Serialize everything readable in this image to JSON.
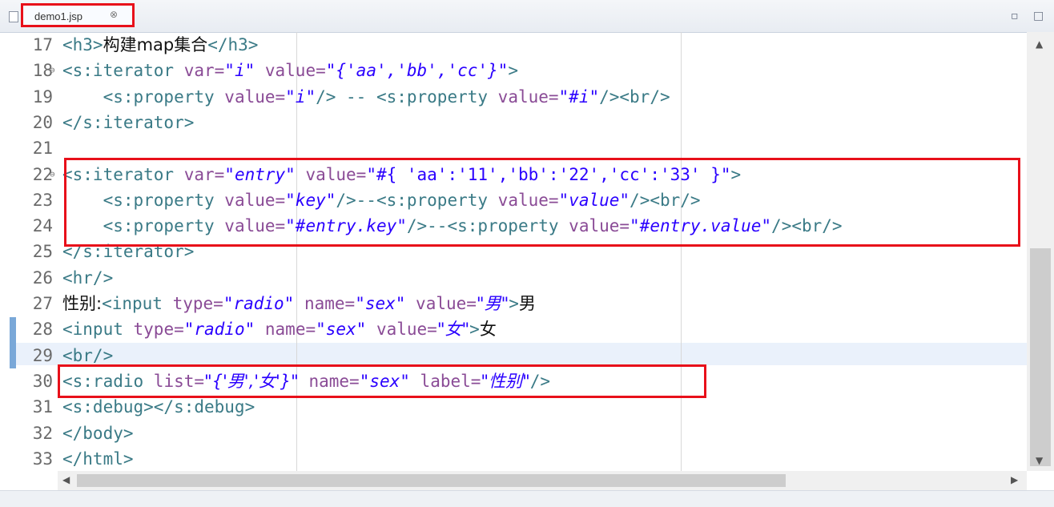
{
  "tab": {
    "label": "demo1.jsp",
    "close": "⊗"
  },
  "window_controls": {
    "minimize": "▫",
    "maximize": "□"
  },
  "code": [
    {
      "ln": "17",
      "fold": "",
      "parts": [
        {
          "t": "<h3>",
          "c": "tag"
        },
        {
          "t": "构建map集合",
          "c": "txt cjk"
        },
        {
          "t": "</h3>",
          "c": "tag"
        }
      ]
    },
    {
      "ln": "18",
      "fold": "⊖",
      "parts": [
        {
          "t": "<s:iterator ",
          "c": "tag"
        },
        {
          "t": "var=",
          "c": "attr"
        },
        {
          "t": "\"i\"",
          "c": "str"
        },
        {
          "t": " value=",
          "c": "attr"
        },
        {
          "t": "\"{'aa','bb','cc'}\"",
          "c": "str"
        },
        {
          "t": ">",
          "c": "tag"
        }
      ]
    },
    {
      "ln": "19",
      "fold": "",
      "parts": [
        {
          "t": "    <s:property ",
          "c": "tag"
        },
        {
          "t": "value=",
          "c": "attr"
        },
        {
          "t": "\"i\"",
          "c": "str"
        },
        {
          "t": "/> -- ",
          "c": "tag"
        },
        {
          "t": "<s:property ",
          "c": "tag"
        },
        {
          "t": "value=",
          "c": "attr"
        },
        {
          "t": "\"#i\"",
          "c": "str"
        },
        {
          "t": "/><br/>",
          "c": "tag"
        }
      ]
    },
    {
      "ln": "20",
      "fold": "",
      "parts": [
        {
          "t": "</s:iterator>",
          "c": "tag"
        }
      ]
    },
    {
      "ln": "21",
      "fold": "",
      "parts": []
    },
    {
      "ln": "22",
      "fold": "⊖",
      "parts": [
        {
          "t": "<s:iterator ",
          "c": "tag"
        },
        {
          "t": "var=",
          "c": "attr"
        },
        {
          "t": "\"entry\"",
          "c": "str"
        },
        {
          "t": " value=",
          "c": "attr"
        },
        {
          "t": "\"#{ 'aa':'11','bb':'22','cc':'33' }\"",
          "c": "strn"
        },
        {
          "t": ">",
          "c": "tag"
        }
      ]
    },
    {
      "ln": "23",
      "fold": "",
      "parts": [
        {
          "t": "    <s:property ",
          "c": "tag"
        },
        {
          "t": "value=",
          "c": "attr"
        },
        {
          "t": "\"key\"",
          "c": "str"
        },
        {
          "t": "/>--",
          "c": "tag"
        },
        {
          "t": "<s:property ",
          "c": "tag"
        },
        {
          "t": "value=",
          "c": "attr"
        },
        {
          "t": "\"value\"",
          "c": "str"
        },
        {
          "t": "/><br/>",
          "c": "tag"
        }
      ]
    },
    {
      "ln": "24",
      "fold": "",
      "parts": [
        {
          "t": "    <s:property ",
          "c": "tag"
        },
        {
          "t": "value=",
          "c": "attr"
        },
        {
          "t": "\"#entry.key\"",
          "c": "str"
        },
        {
          "t": "/>--",
          "c": "tag"
        },
        {
          "t": "<s:property ",
          "c": "tag"
        },
        {
          "t": "value=",
          "c": "attr"
        },
        {
          "t": "\"#entry.value\"",
          "c": "str"
        },
        {
          "t": "/><br/>",
          "c": "tag"
        }
      ]
    },
    {
      "ln": "25",
      "fold": "",
      "parts": [
        {
          "t": "</s:iterator>",
          "c": "tag"
        }
      ]
    },
    {
      "ln": "26",
      "fold": "",
      "parts": [
        {
          "t": "<hr/>",
          "c": "tag"
        }
      ]
    },
    {
      "ln": "27",
      "fold": "",
      "parts": [
        {
          "t": "性别:",
          "c": "txt cjk"
        },
        {
          "t": "<input ",
          "c": "tag"
        },
        {
          "t": "type=",
          "c": "attr"
        },
        {
          "t": "\"radio\"",
          "c": "str"
        },
        {
          "t": " name=",
          "c": "attr"
        },
        {
          "t": "\"sex\"",
          "c": "str"
        },
        {
          "t": " value=",
          "c": "attr"
        },
        {
          "t": "\"男\"",
          "c": "str cjk"
        },
        {
          "t": ">",
          "c": "tag"
        },
        {
          "t": "男",
          "c": "txt cjk"
        }
      ]
    },
    {
      "ln": "28",
      "fold": "",
      "parts": [
        {
          "t": "<input ",
          "c": "tag"
        },
        {
          "t": "type=",
          "c": "attr"
        },
        {
          "t": "\"radio\"",
          "c": "str"
        },
        {
          "t": " name=",
          "c": "attr"
        },
        {
          "t": "\"sex\"",
          "c": "str"
        },
        {
          "t": " value=",
          "c": "attr"
        },
        {
          "t": "\"女\"",
          "c": "str cjk"
        },
        {
          "t": ">",
          "c": "tag"
        },
        {
          "t": "女",
          "c": "txt cjk"
        }
      ]
    },
    {
      "ln": "29",
      "fold": "",
      "parts": [
        {
          "t": "<br/>",
          "c": "tag"
        }
      ]
    },
    {
      "ln": "30",
      "fold": "",
      "parts": [
        {
          "t": "<s:radio ",
          "c": "tag"
        },
        {
          "t": "list=",
          "c": "attr"
        },
        {
          "t": "\"{'男','女'}\"",
          "c": "str cjk"
        },
        {
          "t": " name=",
          "c": "attr"
        },
        {
          "t": "\"sex\"",
          "c": "str"
        },
        {
          "t": " label=",
          "c": "attr"
        },
        {
          "t": "\"性别\"",
          "c": "str cjk"
        },
        {
          "t": "/>",
          "c": "tag"
        }
      ]
    },
    {
      "ln": "31",
      "fold": "",
      "parts": [
        {
          "t": "<s:debug></s:debug>",
          "c": "tag"
        }
      ]
    },
    {
      "ln": "32",
      "fold": "",
      "parts": [
        {
          "t": "</body>",
          "c": "tag"
        }
      ]
    },
    {
      "ln": "33",
      "fold": "",
      "parts": [
        {
          "t": "</html>",
          "c": "tag"
        }
      ]
    }
  ],
  "scroll": {
    "up": "▲",
    "down": "▼",
    "left": "◀",
    "right": "▶"
  },
  "colors": {
    "highlight_box": "#e8101a",
    "tag": "#3a7a86",
    "attribute": "#8a4b96",
    "string": "#2a00ff"
  }
}
